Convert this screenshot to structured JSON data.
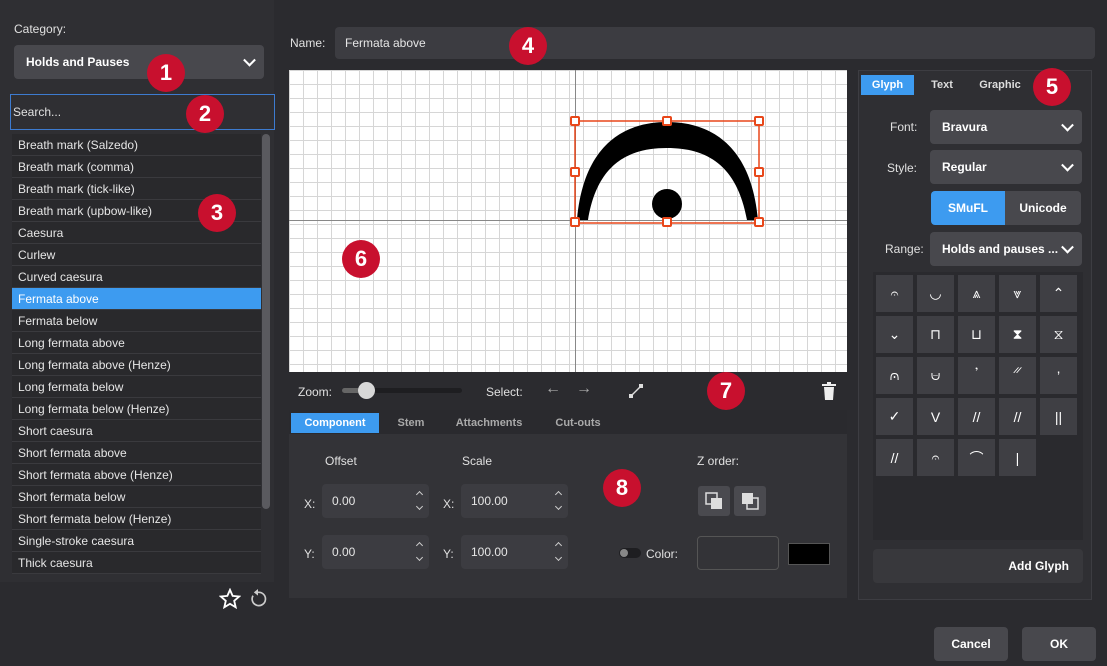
{
  "left": {
    "category_label": "Category:",
    "category_value": "Holds and Pauses",
    "search_placeholder": "Search...",
    "items": [
      "Breath mark (Salzedo)",
      "Breath mark (comma)",
      "Breath mark (tick-like)",
      "Breath mark (upbow-like)",
      "Caesura",
      "Curlew",
      "Curved caesura",
      "Fermata above",
      "Fermata below",
      "Long fermata above",
      "Long fermata above (Henze)",
      "Long fermata below",
      "Long fermata below (Henze)",
      "Short caesura",
      "Short fermata above",
      "Short fermata above (Henze)",
      "Short fermata below",
      "Short fermata below (Henze)",
      "Single-stroke caesura",
      "Thick caesura"
    ],
    "selected_item": "Fermata above"
  },
  "name": {
    "label": "Name:",
    "value": "Fermata above"
  },
  "toolbar": {
    "zoom_label": "Zoom:",
    "select_label": "Select:",
    "zoom_level": 0.15
  },
  "component_tabs": [
    "Component",
    "Stem",
    "Attachments",
    "Cut-outs"
  ],
  "component": {
    "offset_label": "Offset",
    "scale_label": "Scale",
    "zorder_label": "Z order:",
    "x_label": "X:",
    "y_label": "Y:",
    "offset_x": "0.00",
    "offset_y": "0.00",
    "scale_x": "100.00",
    "scale_y": "100.00",
    "color_label": "Color:",
    "color_swatch": "#000000"
  },
  "right": {
    "tabs": [
      "Glyph",
      "Text",
      "Graphic"
    ],
    "font_label": "Font:",
    "font_value": "Bravura",
    "style_label": "Style:",
    "style_value": "Regular",
    "smufl_label": "SMuFL",
    "unicode_label": "Unicode",
    "range_label": "Range:",
    "range_value": "Holds and pauses ...",
    "glyphs": [
      "𝄐",
      "◡",
      "⩓",
      "⩔",
      "⌃",
      "⌄",
      "⊓",
      "⊔",
      "⧗",
      "⧖",
      "⩀",
      "⩁",
      "𝄒",
      "𝄓",
      "’",
      "✓",
      "V",
      "//",
      "//",
      "||",
      "//",
      "𝄐",
      "⌒",
      "|"
    ],
    "add_glyph_label": "Add Glyph"
  },
  "footer": {
    "cancel": "Cancel",
    "ok": "OK"
  },
  "callouts": [
    "1",
    "2",
    "3",
    "4",
    "5",
    "6",
    "7",
    "8"
  ],
  "colors": {
    "accent": "#3d9bf0",
    "callout": "#c8102e",
    "selection": "#e8471a"
  }
}
